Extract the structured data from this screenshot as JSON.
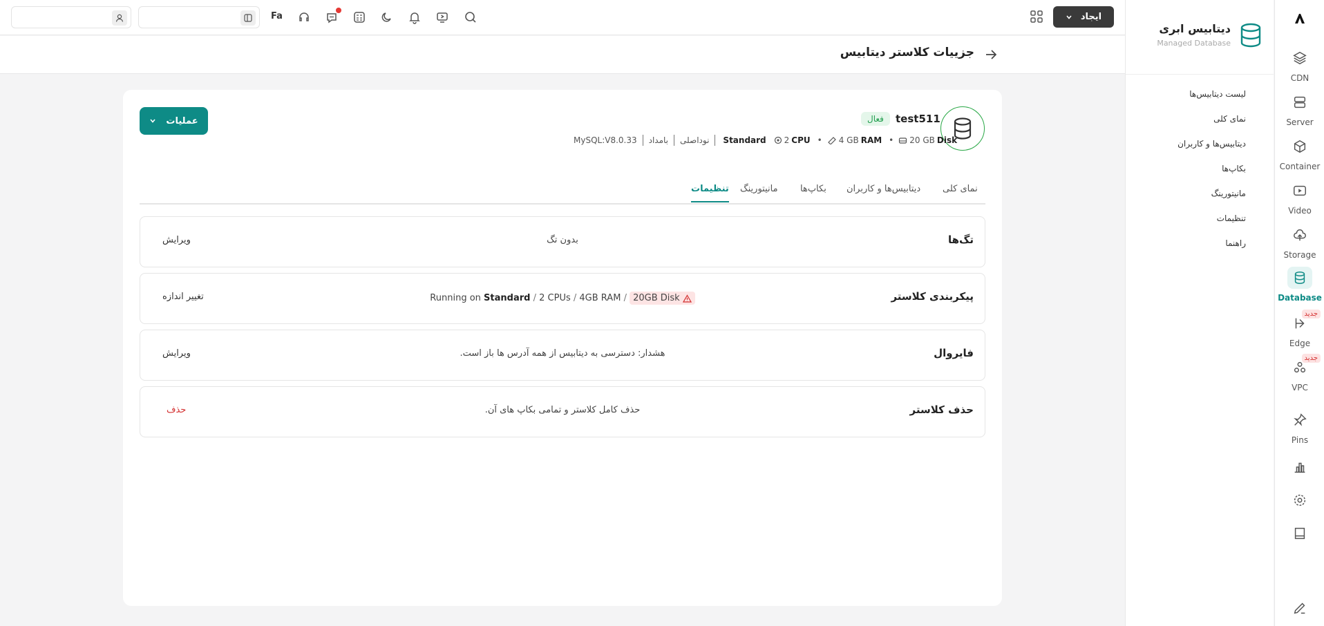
{
  "rail": {
    "items": [
      {
        "label": "CDN",
        "icon": "layers-icon"
      },
      {
        "label": "Server",
        "icon": "server-icon"
      },
      {
        "label": "Container",
        "icon": "cube-icon"
      },
      {
        "label": "Video",
        "icon": "video-icon"
      },
      {
        "label": "Storage",
        "icon": "cloud-icon"
      },
      {
        "label": "Database",
        "icon": "database-icon",
        "active": true
      },
      {
        "label": "Edge",
        "icon": "edge-icon",
        "badge": "جدید"
      },
      {
        "label": "VPC",
        "icon": "vpc-icon",
        "badge": "جدید"
      },
      {
        "label": "Pins",
        "icon": "pin-icon"
      }
    ]
  },
  "subnav": {
    "title": "دیتابیس ابری",
    "subtitle": "Managed Database",
    "items": [
      "لیست دیتابیس‌ها",
      "نمای کلی",
      "دیتابیس‌ها و کاربران",
      "بکاپ‌ها",
      "مانیتورینگ",
      "تنظیمات",
      "راهنما"
    ]
  },
  "topbar": {
    "create_label": "ایجاد",
    "lang_label": "Fa",
    "search_placeholder": "",
    "user_placeholder": ""
  },
  "header": {
    "page_title": "جزییات کلاستر دیتابیس"
  },
  "cluster": {
    "name": "test511",
    "status": "فعال",
    "disk_value": "20 GB",
    "disk_unit": "Disk",
    "ram_value": "4 GB",
    "ram_unit": "RAM",
    "cpu_value": "2",
    "cpu_unit": "CPU",
    "plan": "Standard",
    "type": "نوداصلی",
    "region": "بامداد",
    "engine": "MySQL:V8.0.33",
    "actions_label": "عملیات"
  },
  "tabs": [
    {
      "label": "نمای کلی"
    },
    {
      "label": "دیتابیس‌ها و کاربران"
    },
    {
      "label": "بکاپ‌ها"
    },
    {
      "label": "مانیتورینگ"
    },
    {
      "label": "تنظیمات",
      "active": true
    }
  ],
  "settings": {
    "tags": {
      "title": "تگ‌ها",
      "value": "بدون تگ",
      "action": "ویرایش"
    },
    "sizing": {
      "title": "پیکربندی کلاستر",
      "running_on": "Running on",
      "plan": "Standard",
      "cpus": "2 CPUs",
      "ram": "4GB RAM",
      "disk": "20GB Disk",
      "action": "تغییر اندازه"
    },
    "firewall": {
      "title": "فایروال",
      "value": "هشدار: دسترسی به دیتابیس از همه آدرس ها باز است.",
      "action": "ویرایش"
    },
    "delete": {
      "title": "حذف کلاستر",
      "value": "حذف کامل کلاستر و تمامی بکاپ های آن.",
      "action": "حذف"
    }
  },
  "colors": {
    "accent": "#0e8b86",
    "danger": "#d32f2f",
    "success": "#1f9d4c"
  }
}
